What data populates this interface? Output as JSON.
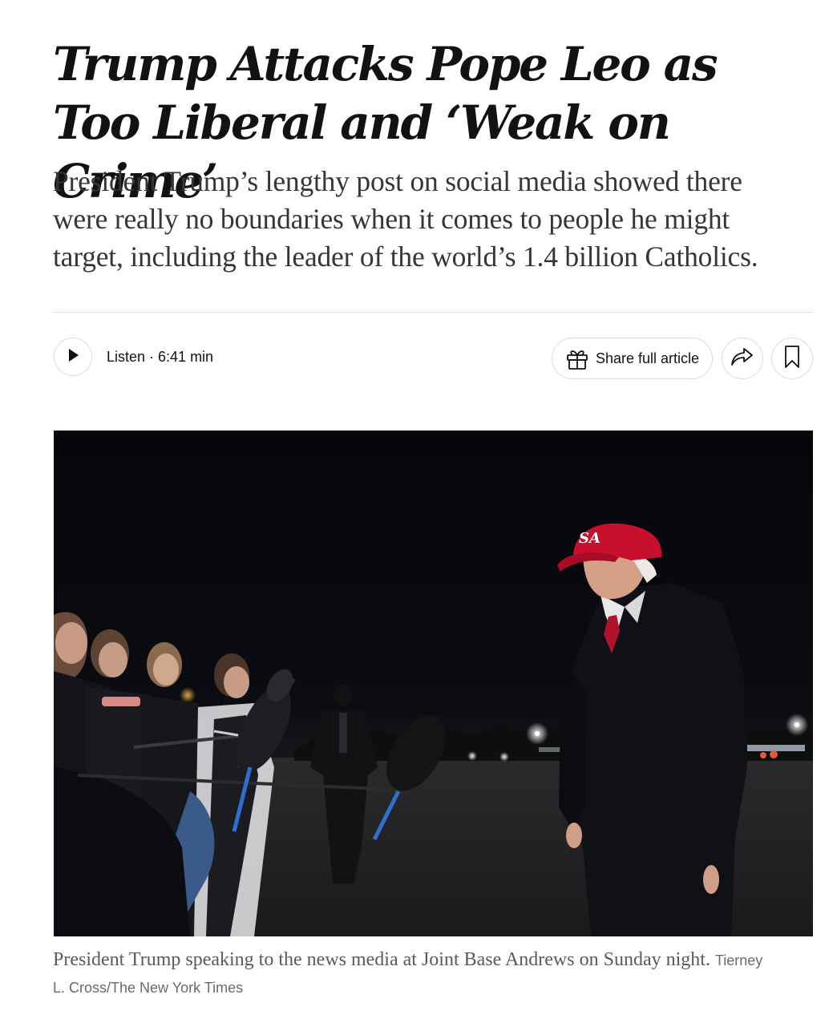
{
  "article": {
    "headline": "Trump Attacks Pope Leo as Too Liberal and ‘Weak on Crime’",
    "summary": "President Trump’s lengthy post on social media showed there were really no boundaries when it comes to people he might target, including the leader of the world’s 1.4 billion Catholics."
  },
  "toolbar": {
    "listen_label": "Listen · 6:41 min",
    "share_label": "Share full article",
    "icons": {
      "play": "play-icon",
      "gift": "gift-icon",
      "share": "share-arrow-icon",
      "save": "bookmark-icon"
    }
  },
  "photo": {
    "caption": "President Trump speaking to the news media at Joint Base Andrews on Sunday night.",
    "credit": "Tierney L. Cross/The New York Times",
    "hat_text": "SA"
  },
  "colors": {
    "text": "#121212",
    "summary": "#363636",
    "caption": "#5a5a5a",
    "border": "#dcdcdc",
    "hat_red": "#c8102e"
  }
}
